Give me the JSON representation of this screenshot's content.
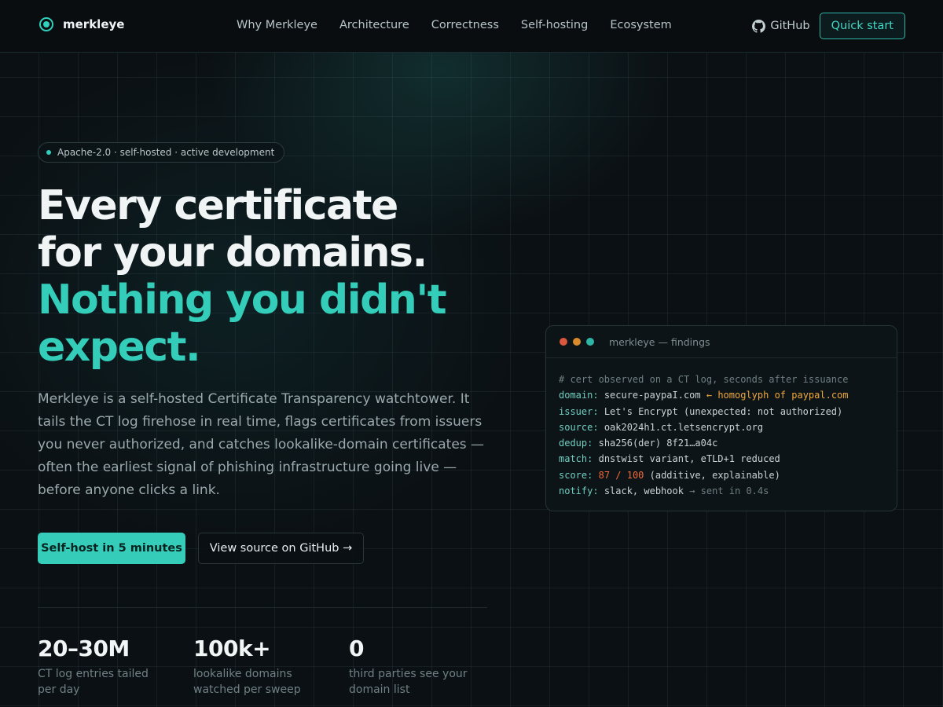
{
  "colors": {
    "accent": "#33cdb9",
    "background": "#0b1014",
    "warning": "#f0a83a",
    "score": "#f06a3a",
    "dot_red": "#d9573d",
    "dot_orange": "#d98a2a",
    "dot_teal": "#2fb5a6"
  },
  "nav": {
    "brand": "merkleye",
    "brand_icon": "eye-ring-icon",
    "links": [
      "Why Merkleye",
      "Architecture",
      "Correctness",
      "Self-hosting",
      "Ecosystem"
    ],
    "github_label": "GitHub",
    "github_icon": "github-icon",
    "quick_start": "Quick start"
  },
  "hero": {
    "badge": "Apache-2.0 · self-hosted · active development",
    "headline_line1": "Every certificate",
    "headline_line2": "for your domains.",
    "headline_accent_line1": "Nothing you didn't",
    "headline_accent_line2": "expect.",
    "lede": "Merkleye is a self-hosted Certificate Transparency watchtower. It tails the CT log firehose in real time, flags certificates from issuers you never authorized, and catches lookalike-domain certificates — often the earliest signal of phishing infrastructure going live — before anyone clicks a link.",
    "cta_primary": "Self-host in 5 minutes",
    "cta_secondary": "View source on GitHub →"
  },
  "stats": [
    {
      "value": "20–30M",
      "label": "CT log entries tailed per day"
    },
    {
      "value": "100k+",
      "label": "lookalike domains watched per sweep"
    },
    {
      "value": "0",
      "label": "third parties see your domain list"
    }
  ],
  "terminal": {
    "title": "merkleye — findings",
    "comment": "# cert observed on a CT log, seconds after issuance",
    "lines": {
      "domain": {
        "key": "domain:",
        "value": "secure-paypaI.com",
        "note": "← homoglyph of paypal.com"
      },
      "issuer": {
        "key": "issuer:",
        "value": "Let's Encrypt (unexpected: not authorized)"
      },
      "source": {
        "key": "source:",
        "value": "oak2024h1.ct.letsencrypt.org"
      },
      "dedup": {
        "key": "dedup:",
        "value": "sha256(der) 8f21…a04c"
      },
      "match": {
        "key": "match:",
        "value": "dnstwist variant, eTLD+1 reduced"
      },
      "score": {
        "key": "score:",
        "value": "87 / 100",
        "note": "(additive, explainable)"
      },
      "notify": {
        "key": "notify:",
        "value": "slack, webhook",
        "note": "→ sent in 0.4s"
      }
    }
  }
}
